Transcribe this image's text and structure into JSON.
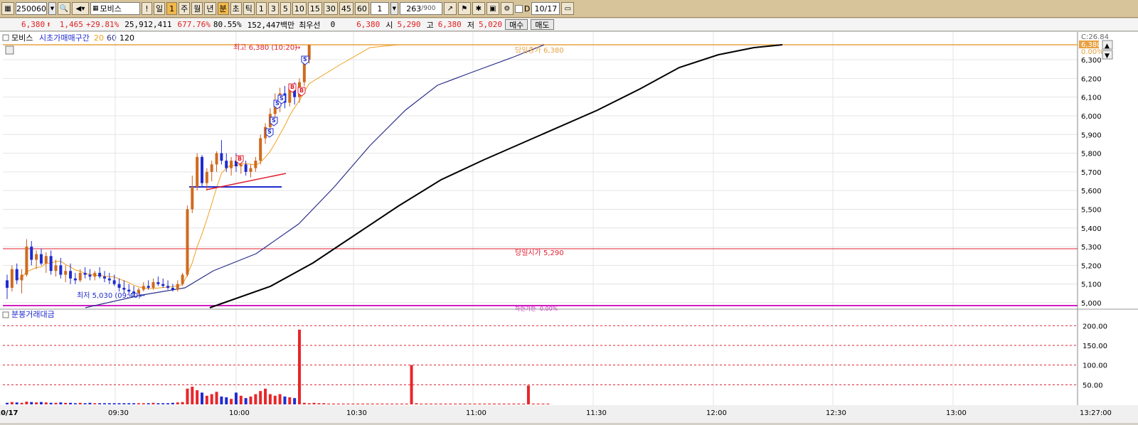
{
  "toolbar": {
    "code": "250060",
    "name": "모비스",
    "period_options": [
      "일",
      "1",
      "주",
      "월",
      "년",
      "분",
      "초",
      "틱",
      "1",
      "3",
      "5",
      "10",
      "15",
      "30",
      "45",
      "60"
    ],
    "active_period": "분",
    "interval_value": "1",
    "count_current": "263",
    "count_total": "/900",
    "date": "10/17"
  },
  "quote": {
    "price": "6,380",
    "change": "1,465",
    "change_pct": "+29.81%",
    "volume": "25,912,411",
    "vol_ratio": "677.76%",
    "turnover_ratio": "80.55%",
    "amount": "152,447백만",
    "best_label": "최우선",
    "best_value": "0",
    "best_price": "6,380",
    "open_label": "시",
    "open_value": "5,290",
    "high_label": "고",
    "high_value": "6,380",
    "low_label": "저",
    "low_value": "5,020",
    "buy_label": "매수",
    "sell_label": "매도"
  },
  "legend": {
    "name": "모비스",
    "indicator": "시초가매매구간",
    "ma1": "20",
    "ma2": "60",
    "ma3": "120"
  },
  "colors": {
    "up": "#e8262a",
    "down": "#1f2bd0",
    "ma20": "#f0a020",
    "ma60": "#2b2f8a",
    "ma120": "#000000",
    "open_line": "#e02030",
    "high_line": "#e8a040",
    "low_line": "#d020c0"
  },
  "annotations": {
    "high_label": "최고 6,380 (10:20)",
    "low_label": "최저 5,030 (09:40)",
    "current_label": "당일종가 6,380",
    "open_label": "당일시가 5,290",
    "lowbound_label": "하한가한 -0.00%"
  },
  "axis": {
    "price_ticks": [
      "6,300",
      "6,200",
      "6,100",
      "6,000",
      "5,900",
      "5,800",
      "5,700",
      "5,600",
      "5,500",
      "5,400",
      "5,300",
      "5,200",
      "5,100",
      "5,000"
    ],
    "top_labels": [
      "C:26.84",
      "6,380",
      "0.00%"
    ],
    "volume_title": "분봉거래대금",
    "volume_ticks": [
      "200.00",
      "150.00",
      "100.00",
      "50.00"
    ],
    "time_labels": [
      "10/17",
      "09:30",
      "10:00",
      "10:30",
      "11:00",
      "11:30",
      "12:00",
      "12:30",
      "13:00",
      "13:27:00"
    ]
  },
  "chart_data": {
    "type": "candlestick",
    "price_range": [
      4980,
      6420
    ],
    "candles": [
      {
        "o": 5120,
        "h": 5150,
        "l": 5020,
        "c": 5080
      },
      {
        "o": 5080,
        "h": 5200,
        "l": 5060,
        "c": 5180
      },
      {
        "o": 5180,
        "h": 5210,
        "l": 5100,
        "c": 5120
      },
      {
        "o": 5120,
        "h": 5180,
        "l": 5050,
        "c": 5150
      },
      {
        "o": 5150,
        "h": 5340,
        "l": 5140,
        "c": 5300
      },
      {
        "o": 5300,
        "h": 5330,
        "l": 5200,
        "c": 5230
      },
      {
        "o": 5230,
        "h": 5280,
        "l": 5180,
        "c": 5260
      },
      {
        "o": 5260,
        "h": 5290,
        "l": 5200,
        "c": 5210
      },
      {
        "o": 5210,
        "h": 5270,
        "l": 5160,
        "c": 5250
      },
      {
        "o": 5250,
        "h": 5280,
        "l": 5150,
        "c": 5170
      },
      {
        "o": 5170,
        "h": 5230,
        "l": 5140,
        "c": 5200
      },
      {
        "o": 5200,
        "h": 5240,
        "l": 5130,
        "c": 5150
      },
      {
        "o": 5150,
        "h": 5200,
        "l": 5110,
        "c": 5170
      },
      {
        "o": 5170,
        "h": 5210,
        "l": 5100,
        "c": 5130
      },
      {
        "o": 5130,
        "h": 5160,
        "l": 5100,
        "c": 5120
      },
      {
        "o": 5120,
        "h": 5180,
        "l": 5110,
        "c": 5160
      },
      {
        "o": 5160,
        "h": 5190,
        "l": 5130,
        "c": 5150
      },
      {
        "o": 5150,
        "h": 5180,
        "l": 5120,
        "c": 5140
      },
      {
        "o": 5140,
        "h": 5170,
        "l": 5120,
        "c": 5160
      },
      {
        "o": 5160,
        "h": 5190,
        "l": 5130,
        "c": 5140
      },
      {
        "o": 5140,
        "h": 5170,
        "l": 5110,
        "c": 5130
      },
      {
        "o": 5130,
        "h": 5160,
        "l": 5100,
        "c": 5120
      },
      {
        "o": 5120,
        "h": 5150,
        "l": 5090,
        "c": 5100
      },
      {
        "o": 5100,
        "h": 5130,
        "l": 5060,
        "c": 5080
      },
      {
        "o": 5080,
        "h": 5120,
        "l": 5050,
        "c": 5070
      },
      {
        "o": 5070,
        "h": 5100,
        "l": 5040,
        "c": 5060
      },
      {
        "o": 5060,
        "h": 5090,
        "l": 5030,
        "c": 5050
      },
      {
        "o": 5050,
        "h": 5080,
        "l": 5040,
        "c": 5070
      },
      {
        "o": 5070,
        "h": 5110,
        "l": 5060,
        "c": 5090
      },
      {
        "o": 5090,
        "h": 5120,
        "l": 5070,
        "c": 5080
      },
      {
        "o": 5080,
        "h": 5130,
        "l": 5070,
        "c": 5110
      },
      {
        "o": 5110,
        "h": 5140,
        "l": 5090,
        "c": 5100
      },
      {
        "o": 5100,
        "h": 5130,
        "l": 5080,
        "c": 5090
      },
      {
        "o": 5090,
        "h": 5120,
        "l": 5070,
        "c": 5080
      },
      {
        "o": 5080,
        "h": 5100,
        "l": 5060,
        "c": 5070
      },
      {
        "o": 5070,
        "h": 5120,
        "l": 5060,
        "c": 5100
      },
      {
        "o": 5100,
        "h": 5160,
        "l": 5090,
        "c": 5150
      },
      {
        "o": 5150,
        "h": 5520,
        "l": 5140,
        "c": 5500
      },
      {
        "o": 5500,
        "h": 5680,
        "l": 5480,
        "c": 5620
      },
      {
        "o": 5620,
        "h": 5800,
        "l": 5600,
        "c": 5780
      },
      {
        "o": 5780,
        "h": 5790,
        "l": 5620,
        "c": 5640
      },
      {
        "o": 5640,
        "h": 5720,
        "l": 5600,
        "c": 5700
      },
      {
        "o": 5700,
        "h": 5760,
        "l": 5650,
        "c": 5740
      },
      {
        "o": 5740,
        "h": 5810,
        "l": 5700,
        "c": 5800
      },
      {
        "o": 5800,
        "h": 5870,
        "l": 5740,
        "c": 5760
      },
      {
        "o": 5760,
        "h": 5800,
        "l": 5700,
        "c": 5720
      },
      {
        "o": 5720,
        "h": 5780,
        "l": 5680,
        "c": 5760
      },
      {
        "o": 5760,
        "h": 5800,
        "l": 5700,
        "c": 5730
      },
      {
        "o": 5730,
        "h": 5770,
        "l": 5690,
        "c": 5740
      },
      {
        "o": 5740,
        "h": 5760,
        "l": 5680,
        "c": 5700
      },
      {
        "o": 5700,
        "h": 5740,
        "l": 5670,
        "c": 5720
      },
      {
        "o": 5720,
        "h": 5780,
        "l": 5700,
        "c": 5760
      },
      {
        "o": 5760,
        "h": 5900,
        "l": 5740,
        "c": 5880
      },
      {
        "o": 5880,
        "h": 5960,
        "l": 5850,
        "c": 5940
      },
      {
        "o": 5940,
        "h": 6040,
        "l": 5920,
        "c": 6010
      },
      {
        "o": 6010,
        "h": 6120,
        "l": 5980,
        "c": 6080
      },
      {
        "o": 6080,
        "h": 6150,
        "l": 6020,
        "c": 6120
      },
      {
        "o": 6120,
        "h": 6160,
        "l": 6040,
        "c": 6070
      },
      {
        "o": 6070,
        "h": 6170,
        "l": 6050,
        "c": 6150
      },
      {
        "o": 6150,
        "h": 6180,
        "l": 6060,
        "c": 6100
      },
      {
        "o": 6100,
        "h": 6200,
        "l": 6070,
        "c": 6180
      },
      {
        "o": 6180,
        "h": 6320,
        "l": 6160,
        "c": 6300
      },
      {
        "o": 6300,
        "h": 6380,
        "l": 6280,
        "c": 6380
      }
    ],
    "volumes": [
      4,
      6,
      5,
      4,
      7,
      6,
      5,
      6,
      5,
      4,
      4,
      5,
      4,
      4,
      3,
      4,
      3,
      4,
      3,
      3,
      3,
      3,
      3,
      3,
      3,
      3,
      3,
      3,
      3,
      3,
      4,
      3,
      3,
      3,
      4,
      5,
      6,
      40,
      45,
      36,
      30,
      22,
      26,
      32,
      20,
      18,
      14,
      30,
      22,
      16,
      20,
      26,
      34,
      40,
      26,
      22,
      26,
      20,
      18,
      16,
      190,
      4,
      3,
      4,
      3,
      3,
      2,
      2,
      2,
      2,
      2,
      2,
      2,
      2,
      2,
      2,
      2,
      2,
      2,
      2,
      2,
      2,
      2,
      100,
      3,
      2,
      2,
      2,
      2,
      2,
      2,
      2,
      2,
      2,
      2,
      2,
      2,
      2,
      2,
      2,
      2,
      2,
      2,
      2,
      2,
      2,
      2,
      48,
      2,
      2,
      2,
      2
    ]
  }
}
